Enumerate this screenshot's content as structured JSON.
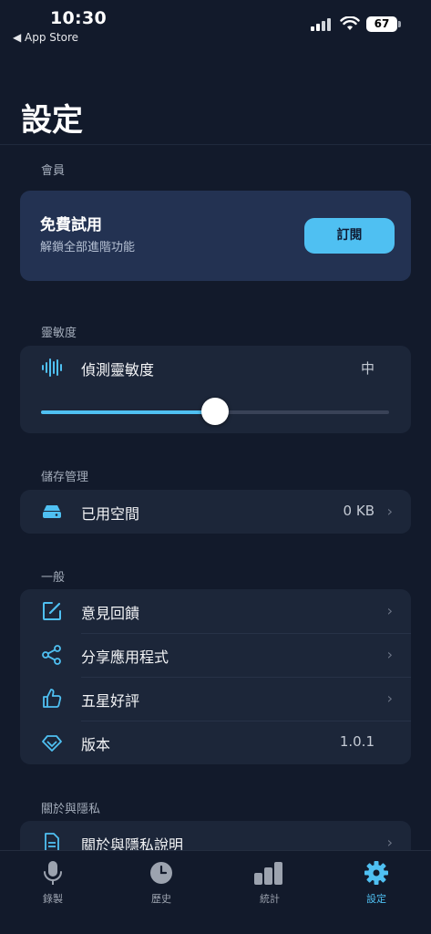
{
  "status_bar": {
    "time": "10:30",
    "back_app": "◀ App Store",
    "battery": "67"
  },
  "page": {
    "title": "設定"
  },
  "membership": {
    "section_label": "會員",
    "title": "免費試用",
    "subtitle": "解鎖全部進階功能",
    "button_label": "訂閱"
  },
  "sensitivity": {
    "section_label": "靈敏度",
    "label": "偵測靈敏度",
    "value": "中",
    "slider_level": 0.5
  },
  "storage": {
    "section_label": "儲存管理",
    "label": "已用空間",
    "value": "0 KB"
  },
  "general": {
    "section_label": "一般",
    "items": [
      {
        "label": "意見回饋",
        "icon": "edit-icon"
      },
      {
        "label": "分享應用程式",
        "icon": "share-icon"
      },
      {
        "label": "五星好評",
        "icon": "thumbs-up-icon"
      },
      {
        "label": "版本",
        "value": "1.0.1",
        "icon": "diamond-icon"
      }
    ]
  },
  "about": {
    "section_label": "關於與隱私",
    "items": [
      {
        "label": "關於與隱私說明",
        "icon": "document-icon"
      }
    ]
  },
  "tabbar": {
    "tabs": [
      {
        "label": "錄製",
        "icon": "microphone-icon"
      },
      {
        "label": "歷史",
        "icon": "clock-icon"
      },
      {
        "label": "統計",
        "icon": "bar-chart-icon"
      },
      {
        "label": "設定",
        "icon": "gear-icon",
        "active": true
      }
    ]
  },
  "colors": {
    "accent": "#4fc0f2",
    "background": "#121a2b",
    "card": "#1c2639",
    "member_card": "#233252"
  }
}
